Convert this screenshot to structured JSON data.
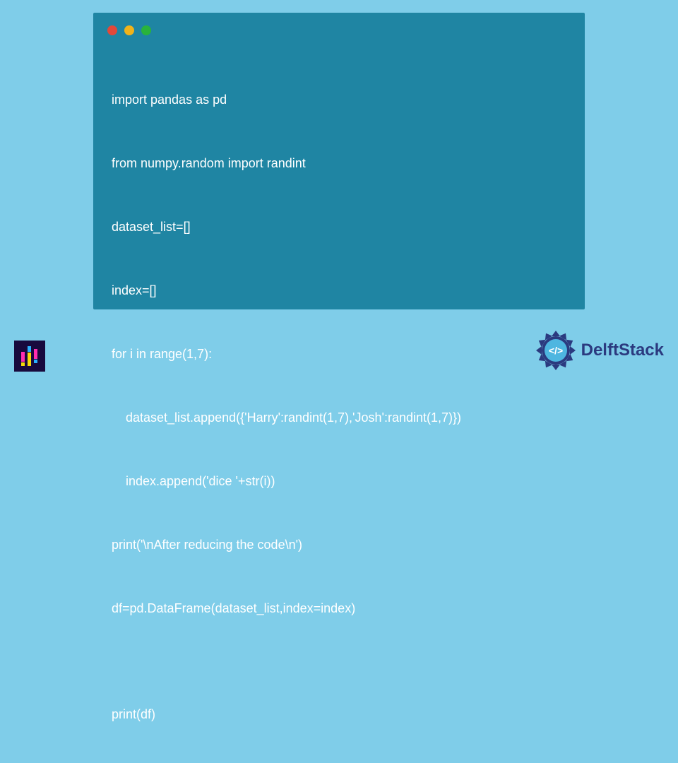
{
  "code": {
    "lines": [
      "import pandas as pd",
      "from numpy.random import randint",
      "dataset_list=[]",
      "index=[]",
      "for i in range(1,7):",
      "    dataset_list.append({'Harry':randint(1,7),'Josh':randint(1,7)})",
      "    index.append('dice '+str(i))",
      "print('\\nAfter reducing the code\\n')",
      "df=pd.DataFrame(dataset_list,index=index)",
      "",
      "print(df)"
    ]
  },
  "brand": {
    "name": "DelftStack"
  },
  "colors": {
    "page_bg": "#7fcde9",
    "window_bg": "#1f85a3",
    "code_text": "#ffffff",
    "brand_text": "#2b3a7f",
    "logo_bg": "#180a3d",
    "traffic_red": "#e24839",
    "traffic_yellow": "#f0b31a",
    "traffic_green": "#29b33c"
  }
}
